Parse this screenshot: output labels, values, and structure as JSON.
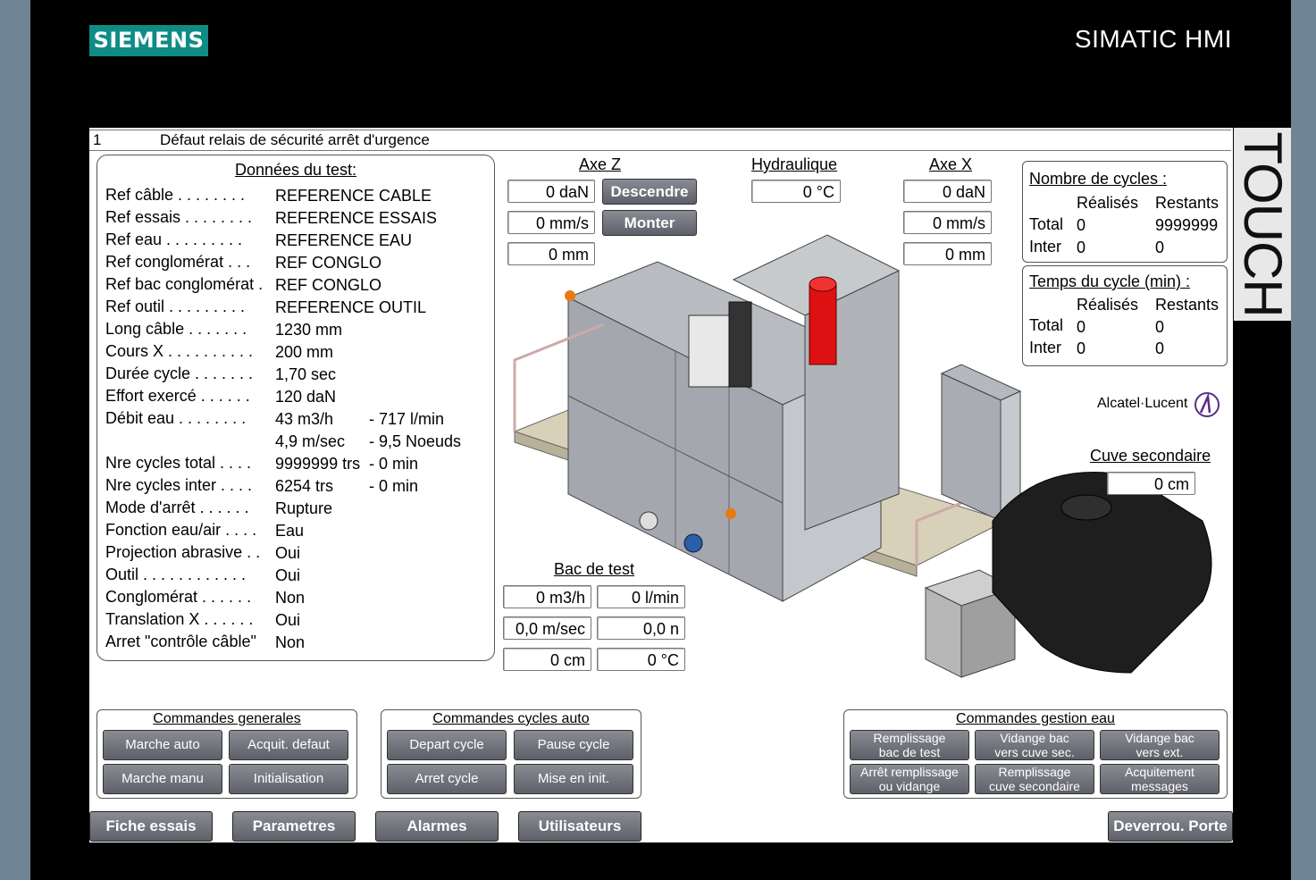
{
  "header": {
    "brand_logo": "SIEMENS",
    "product": "SIMATIC HMI",
    "side_label": "TOUCH"
  },
  "alarm": {
    "number": "1",
    "text": "Défaut relais de sécurité arrêt d'urgence"
  },
  "test_data": {
    "title": "Données du test:",
    "rows": [
      {
        "label": "Ref câble . . . . . . . .",
        "value": "REFERENCE CABLE"
      },
      {
        "label": "Ref essais . . . . . . . .",
        "value": "REFERENCE ESSAIS"
      },
      {
        "label": "Ref eau  . . . . . . . . .",
        "value": "REFERENCE EAU"
      },
      {
        "label": "Ref conglomérat  . . .",
        "value": "REF CONGLO"
      },
      {
        "label": "Ref bac conglomérat .",
        "value": "REF CONGLO"
      },
      {
        "label": "Ref outil  . . . . . . . . .",
        "value": "REFERENCE OUTIL"
      },
      {
        "label": "Long câble  . . . . . . .",
        "value": "1230 mm"
      },
      {
        "label": "Cours X . . . . . . . . . .",
        "value": "200 mm"
      },
      {
        "label": "Durée cycle . . . . . . .",
        "value": "1,70 sec"
      },
      {
        "label": "Effort exercé  . . . . . .",
        "value": "120 daN"
      },
      {
        "label": "Débit eau  . . . . . . . .",
        "value": "43 m3/h",
        "extra": "-  717 l/min"
      },
      {
        "label": "",
        "value": "4,9 m/sec",
        "extra": "-  9,5 Noeuds"
      },
      {
        "label": "Nre cycles total  . . . .",
        "value": "9999999 trs",
        "extra": "-  0 min"
      },
      {
        "label": "Nre cycles inter  . . . .",
        "value": "6254 trs",
        "extra": "-  0 min"
      },
      {
        "label": "Mode d'arrêt  . . . . . .",
        "value": "Rupture"
      },
      {
        "label": "Fonction eau/air . . . .",
        "value": "Eau"
      },
      {
        "label": "Projection abrasive . .",
        "value": "Oui"
      },
      {
        "label": "Outil . . . . . . . . . . . .",
        "value": "Oui"
      },
      {
        "label": "Conglomérat  . . . . . .",
        "value": "Non"
      },
      {
        "label": "Translation X  . . . . . .",
        "value": "Oui"
      },
      {
        "label": "Arret \"contrôle câble\"",
        "value": "Non"
      }
    ]
  },
  "axe_z": {
    "title": "Axe Z",
    "force": "0 daN",
    "speed": "0 mm/s",
    "pos": "0 mm",
    "btn_down": "Descendre",
    "btn_up": "Monter"
  },
  "hydraulique": {
    "title": "Hydraulique",
    "temp": "0 °C"
  },
  "axe_x": {
    "title": "Axe X",
    "force": "0 daN",
    "speed": "0 mm/s",
    "pos": "0 mm"
  },
  "cycles": {
    "title": "Nombre de cycles :",
    "col1": "Réalisés",
    "col2": "Restants",
    "total_label": "Total",
    "total_done": "0",
    "total_left": "9999999",
    "inter_label": "Inter",
    "inter_done": "0",
    "inter_left": "0"
  },
  "cycle_time": {
    "title": "Temps du cycle (min) :",
    "col1": "Réalisés",
    "col2": "Restants",
    "total_label": "Total",
    "total_done": "0",
    "total_left": "0",
    "inter_label": "Inter",
    "inter_done": "0",
    "inter_left": "0"
  },
  "partner_logo": "Alcatel·Lucent",
  "cuve": {
    "title": "Cuve secondaire",
    "level": "0 cm"
  },
  "bac": {
    "title": "Bac de test",
    "flow_m3h": "0 m3/h",
    "flow_lmin": "0 l/min",
    "speed": "0,0 m/sec",
    "knots": "0,0 n",
    "level": "0 cm",
    "temp": "0 °C"
  },
  "cmd_gen": {
    "title": "Commandes generales",
    "b1": "Marche auto",
    "b2": "Acquit. defaut",
    "b3": "Marche manu",
    "b4": "Initialisation"
  },
  "cmd_auto": {
    "title": "Commandes cycles auto",
    "b1": "Depart cycle",
    "b2": "Pause cycle",
    "b3": "Arret cycle",
    "b4": "Mise en init."
  },
  "cmd_eau": {
    "title": "Commandes gestion eau",
    "b1a": "Remplissage",
    "b1b": "bac de test",
    "b2a": "Vidange bac",
    "b2b": "vers cuve sec.",
    "b3a": "Vidange bac",
    "b3b": "vers ext.",
    "b4a": "Arrêt remplissage",
    "b4b": "ou vidange",
    "b5a": "Remplissage",
    "b5b": "cuve secondaire",
    "b6a": "Acquitement",
    "b6b": "messages"
  },
  "nav": {
    "fiche": "Fiche essais",
    "params": "Parametres",
    "alarms": "Alarmes",
    "users": "Utilisateurs",
    "door": "Deverrou. Porte"
  }
}
